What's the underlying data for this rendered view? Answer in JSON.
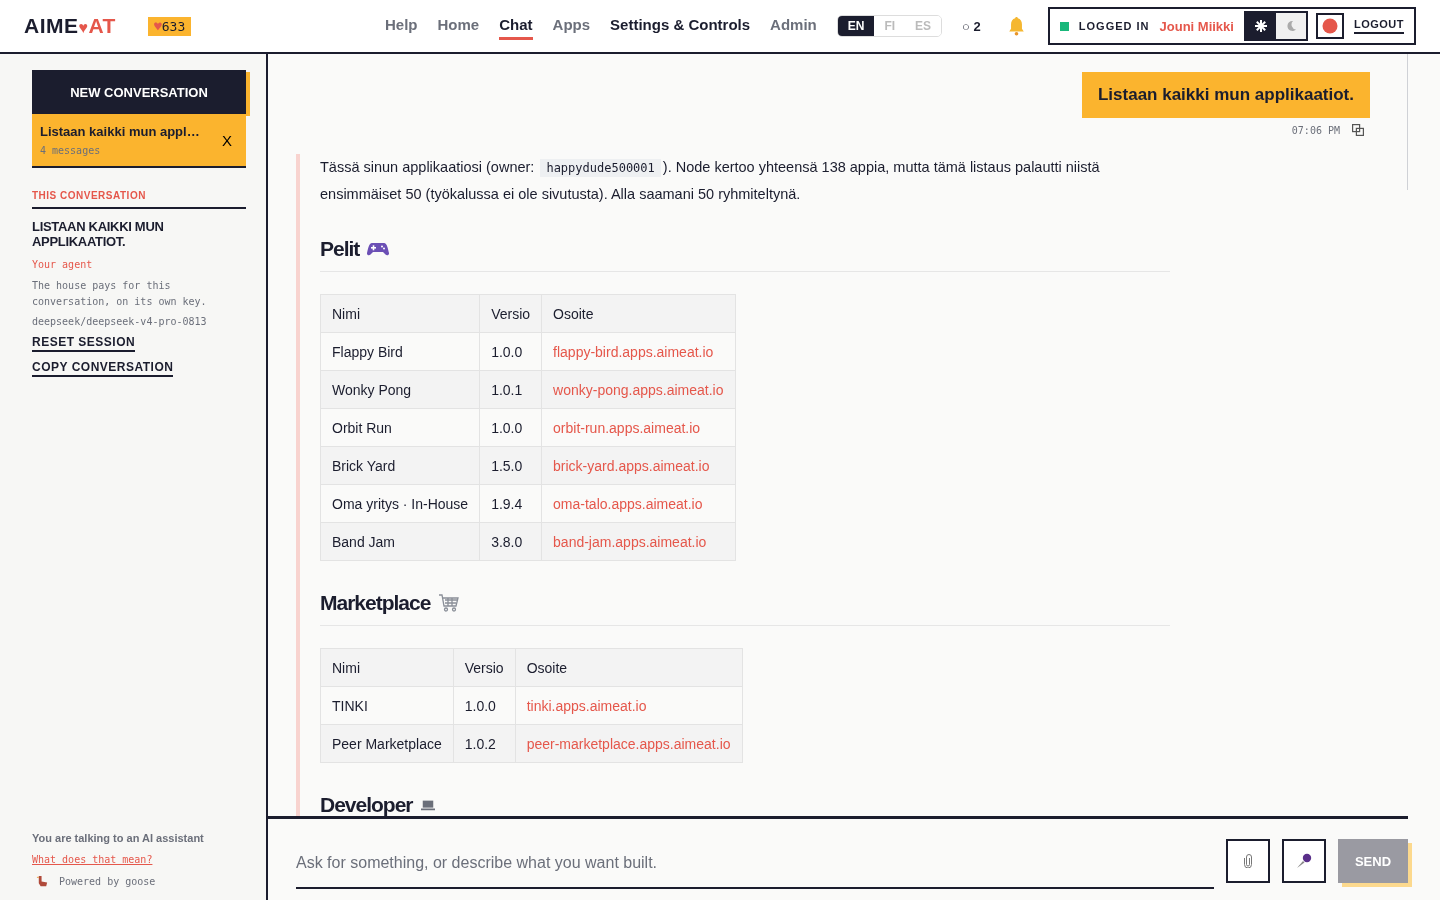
{
  "header": {
    "logo": {
      "left": "AIME",
      "heart": "♥",
      "right": "AT"
    },
    "credits": {
      "icon": "♥",
      "value": "633"
    },
    "nav": [
      {
        "label": "Help",
        "selected": false,
        "highlighted": false
      },
      {
        "label": "Home",
        "selected": false,
        "highlighted": false
      },
      {
        "label": "Chat",
        "selected": true,
        "highlighted": false
      },
      {
        "label": "Apps",
        "selected": false,
        "highlighted": false
      },
      {
        "label": "Settings & Controls",
        "selected": false,
        "highlighted": true
      },
      {
        "label": "Admin",
        "selected": false,
        "highlighted": false
      }
    ],
    "languages": [
      {
        "label": "EN",
        "selected": true
      },
      {
        "label": "FI",
        "selected": false
      },
      {
        "label": "ES",
        "selected": false
      }
    ],
    "notifications": "○ 2",
    "status": {
      "label": "LOGGED IN",
      "user": "Jouni Miikki",
      "online": true
    },
    "theme": [
      {
        "kind": "light",
        "selected": true
      },
      {
        "kind": "dark",
        "selected": false
      }
    ],
    "logout": "LOGOUT"
  },
  "sidebar": {
    "new_button": "NEW CONVERSATION",
    "conversations": [
      {
        "title": "Listaan kaikki mun appl…",
        "meta": "4 messages",
        "close": "X",
        "selected": true
      }
    ],
    "section_title": "THIS CONVERSATION",
    "conversation_title": "LISTAAN KAIKKI MUN APPLIKAATIOT.",
    "agent_label": "Your agent",
    "agent_note": "The house pays for this conversation, on its own key.",
    "model": "deepseek/deepseek-v4-pro-0813",
    "actions": [
      "RESET SESSION",
      "COPY CONVERSATION"
    ],
    "footer": {
      "notice": "You are talking to an AI assistant",
      "link": "What does that mean?",
      "powered": "Powered by goose"
    }
  },
  "messages": [
    {
      "kind": "user",
      "text": "Listaan kaikki mun applikaatiot.",
      "time": "07:06 PM"
    },
    {
      "kind": "assistant",
      "intro": [
        {
          "kind": "text",
          "text": "Tässä sinun applikaatiosi (owner: "
        },
        {
          "kind": "code",
          "text": "happydude500001"
        },
        {
          "kind": "text",
          "text": "). Node kertoo yhteensä 138 appia, mutta tämä listaus palautti niistä ensimmäiset 50 (työkalussa ei ole sivutusta). Alla saamani 50 ryhmiteltynä."
        }
      ],
      "sections": [
        {
          "title": "Pelit",
          "table": {
            "columns": [
              {
                "label": "Nimi",
                "kind": "text"
              },
              {
                "label": "Versio",
                "kind": "text"
              },
              {
                "label": "Osoite",
                "kind": "link"
              }
            ],
            "rows": [
              [
                "Flappy Bird",
                "1.0.0",
                "flappy-bird.apps.aimeat.io"
              ],
              [
                "Wonky Pong",
                "1.0.1",
                "wonky-pong.apps.aimeat.io"
              ],
              [
                "Orbit Run",
                "1.0.0",
                "orbit-run.apps.aimeat.io"
              ],
              [
                "Brick Yard",
                "1.5.0",
                "brick-yard.apps.aimeat.io"
              ],
              [
                "Oma yritys · In-House",
                "1.9.4",
                "oma-talo.apps.aimeat.io"
              ],
              [
                "Band Jam",
                "3.8.0",
                "band-jam.apps.aimeat.io"
              ]
            ]
          }
        },
        {
          "title": "Marketplace",
          "table": {
            "columns": [
              {
                "label": "Nimi",
                "kind": "text"
              },
              {
                "label": "Versio",
                "kind": "text"
              },
              {
                "label": "Osoite",
                "kind": "link"
              }
            ],
            "rows": [
              [
                "TINKI",
                "1.0.0",
                "tinki.apps.aimeat.io"
              ],
              [
                "Peer Marketplace",
                "1.0.2",
                "peer-marketplace.apps.aimeat.io"
              ]
            ]
          }
        },
        {
          "title": "Developer"
        }
      ]
    }
  ],
  "composer": {
    "placeholder": "Ask for something, or describe what you want built.",
    "send": "SEND",
    "send_disabled": true
  }
}
